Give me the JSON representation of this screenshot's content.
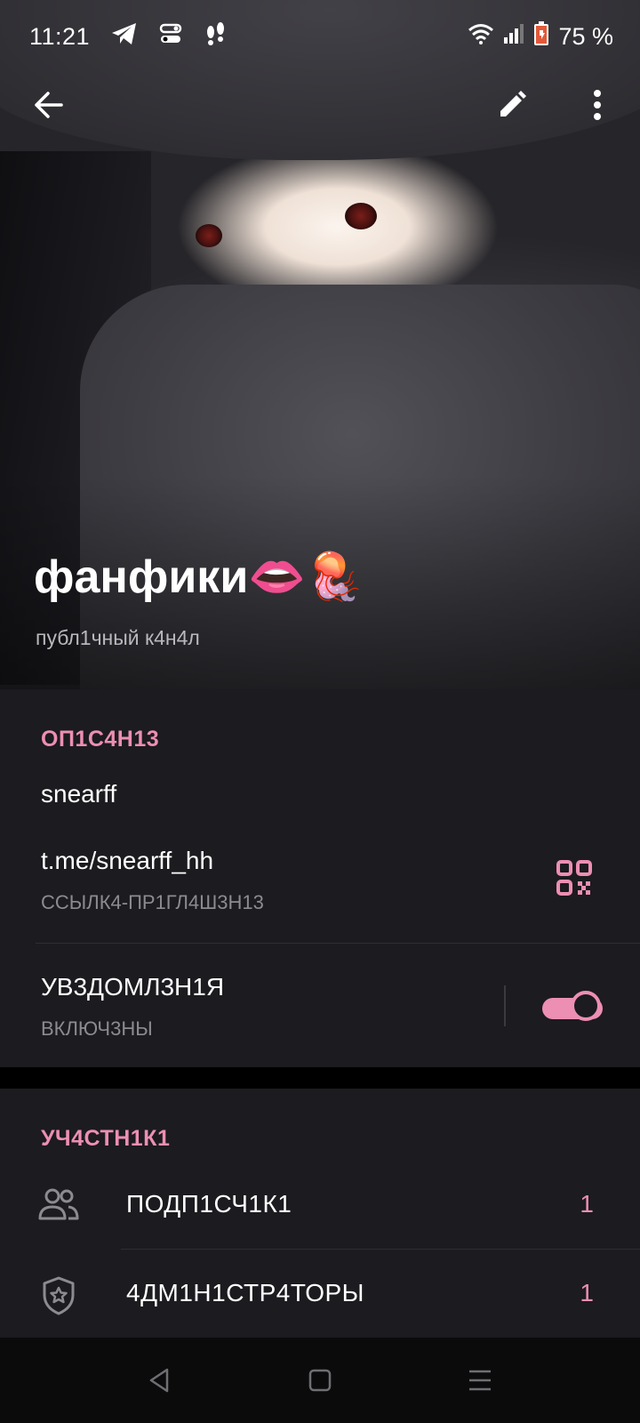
{
  "status_bar": {
    "time": "11:21",
    "battery": "75 %",
    "icons": [
      "telegram-icon",
      "toggle-status-icon",
      "footprints-icon",
      "wifi-icon",
      "signal-icon",
      "battery-icon"
    ]
  },
  "app_bar": {
    "back_icon": "arrow-left-icon",
    "edit_icon": "pencil-icon",
    "menu_icon": "more-vertical-icon"
  },
  "channel": {
    "name": "фанфики👄🪼",
    "subtitle": "публ1чный к4н4л"
  },
  "info": {
    "section_title": "ОП1С4Н13",
    "description": "snearff",
    "link": "t.me/snearff_hh",
    "link_caption": "ССЫЛК4-ПР1ГЛ4Ш3Н13",
    "notifications_label": "УВ3ДОМЛ3Н1Я",
    "notifications_state": "ВКЛЮЧ3НЫ",
    "notifications_on": true
  },
  "members": {
    "section_title": "УЧ4СТН1К1",
    "rows": [
      {
        "label": "ПОДП1СЧ1К1",
        "count": "1",
        "icon": "users-icon"
      },
      {
        "label": "4ДМ1Н1СТР4ТОРЫ",
        "count": "1",
        "icon": "shield-star-icon"
      }
    ]
  },
  "colors": {
    "accent": "#ec8fb3",
    "card": "#1c1b1f",
    "background": "#000000"
  }
}
